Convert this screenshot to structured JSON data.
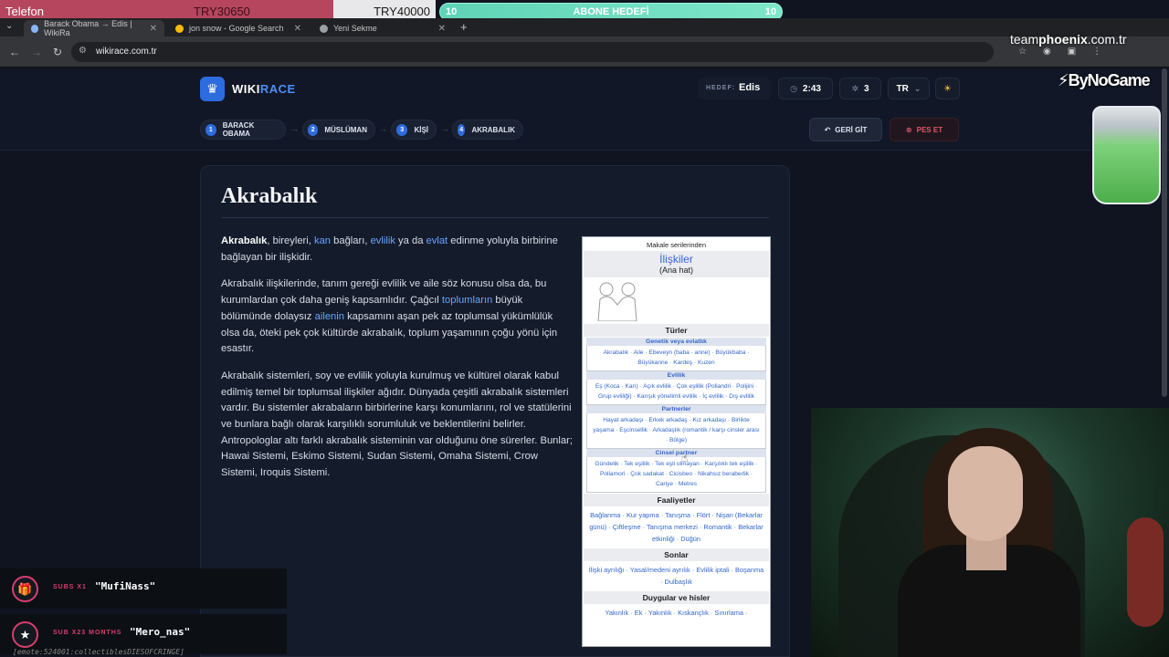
{
  "overlay": {
    "goal_left_label": "Telefon",
    "goal_left_value": "TRY30650",
    "goal_right_value": "TRY40000",
    "sub_goal_left": "10",
    "sub_goal_title": "ABONE HEDEFİ",
    "sub_goal_right": "10",
    "brand_prefix": "team",
    "brand_bold": "phoenix",
    "brand_suffix": ".com.tr",
    "sponsor": "ByNoGame",
    "alerts": [
      {
        "tag": "SUBS X1",
        "user": "\"MufiNass\""
      },
      {
        "tag": "SUB X23 MONTHS",
        "user": "\"Mero_nas\""
      }
    ],
    "emote_text": "[emote:524001:collectiblesDIESOFCRINGE]"
  },
  "browser": {
    "tabs": [
      {
        "title": "Barack Obama → Edis | WikiRa",
        "active": true
      },
      {
        "title": "jon snow - Google Search",
        "active": false
      },
      {
        "title": "Yeni Sekme",
        "active": false
      }
    ],
    "url": "wikirace.com.tr"
  },
  "site": {
    "logo_white": "WIKI",
    "logo_blue": "RACE",
    "target_label": "HEDEF:",
    "target_value": "Edis",
    "timer": "2:43",
    "clicks": "3",
    "language": "TR",
    "steps": [
      {
        "n": "1",
        "label": "BARACK OBAMA"
      },
      {
        "n": "2",
        "label": "MÜSLÜMAN"
      },
      {
        "n": "3",
        "label": "KİŞİ"
      },
      {
        "n": "4",
        "label": "AKRABALIK"
      }
    ],
    "back_label": "GERİ GİT",
    "give_up_label": "PES ET"
  },
  "article": {
    "title": "Akrabalık",
    "p1_bold": "Akrabalık",
    "p1_a": ", bireyleri, ",
    "p1_l1": "kan",
    "p1_b": " bağları, ",
    "p1_l2": "evlilik",
    "p1_c": " ya da ",
    "p1_l3": "evlat",
    "p1_d": " edinme yoluyla birbirine bağlayan bir ilişkidir.",
    "p2_a": "Akrabalık ilişkilerinde, tanım gereği evlilik ve aile söz konusu olsa da, bu kurumlardan çok daha geniş kapsamlıdır. Çağcıl ",
    "p2_l1": "toplumların",
    "p2_b": " büyük bölümünde dolaysız ",
    "p2_l2": "ailenin",
    "p2_c": " kapsamını aşan pek az toplumsal yükümlülük olsa da, öteki pek çok kültürde akrabalık, toplum yaşamının çoğu yönü için esastır.",
    "p3": "Akrabalık sistemleri, soy ve evlilik yoluyla kurulmuş ve kültürel olarak kabul edilmiş temel bir toplumsal ilişkiler ağıdır. Dünyada çeşitli akrabalık sistemleri vardır. Bu sistemler akrabaların birbirlerine karşı konumlarını, rol ve statülerini ve bunlara bağlı olarak karşılıklı sorumluluk ve beklentilerini belirler. Antropologlar altı farklı akrabalık sisteminin var olduğunu öne sürerler. Bunlar; Hawai Sistemi, Eskimo Sistemi, Sudan Sistemi, Omaha Sistemi, Crow Sistemi, Iroquis Sistemi."
  },
  "infobox": {
    "series": "Makale serilerinden",
    "title": "İlişkiler",
    "subtitle": "(Ana hat)",
    "sections": [
      {
        "title": "Türler",
        "subs": [
          {
            "title": "Genetik veya evlatlık",
            "items": "Akrabalık · Aile · Ebeveyn (baba · anne) · Büyükbaba · Büyükanne · Kardeş · Kuzen"
          },
          {
            "title": "Evlilik",
            "items": "Eş (Koca · Karı) · Açık evlilik · Çok eşlilik (Poliandri · Polijini · Grup evliliği) · Karışık yönelimli evlilik · İç evlilik · Dış evlilik"
          },
          {
            "title": "Partnerler",
            "items": "Hayat arkadaşı · Erkek arkadaş · Kız arkadaşı · Birlikte yaşama · Eşcinsellik · Arkadaşlık (romantik / karşı cinsler arası · Bölge)"
          },
          {
            "title": "Cinsel partner",
            "items": "Gündelik · Tek eşlilik · Tek eşli olmayan · Karşılıklı tek eşlilik · Poliamori · Çok sadakat · Cicisbeo · Nikahsız beraberlik · Cariye · Metres"
          }
        ]
      },
      {
        "title": "Faaliyetler",
        "items": "Bağlanma · Kur yapma · Tanışma · Flört · Nişan (Bekarlar günü) · Çiftleşme · Tanışma merkezi · Romantik · Bekarlar etkinliği · Düğün"
      },
      {
        "title": "Sonlar",
        "items": "İlişki ayrılığı · Yasal/medeni ayrılık · Evlilik iptali · Boşanma · Dulbaşlık"
      },
      {
        "title": "Duygular ve hisler",
        "items": "Yakınlık · Ek · Yakınlık · Kıskançlık · Sınırlama ·"
      }
    ]
  }
}
